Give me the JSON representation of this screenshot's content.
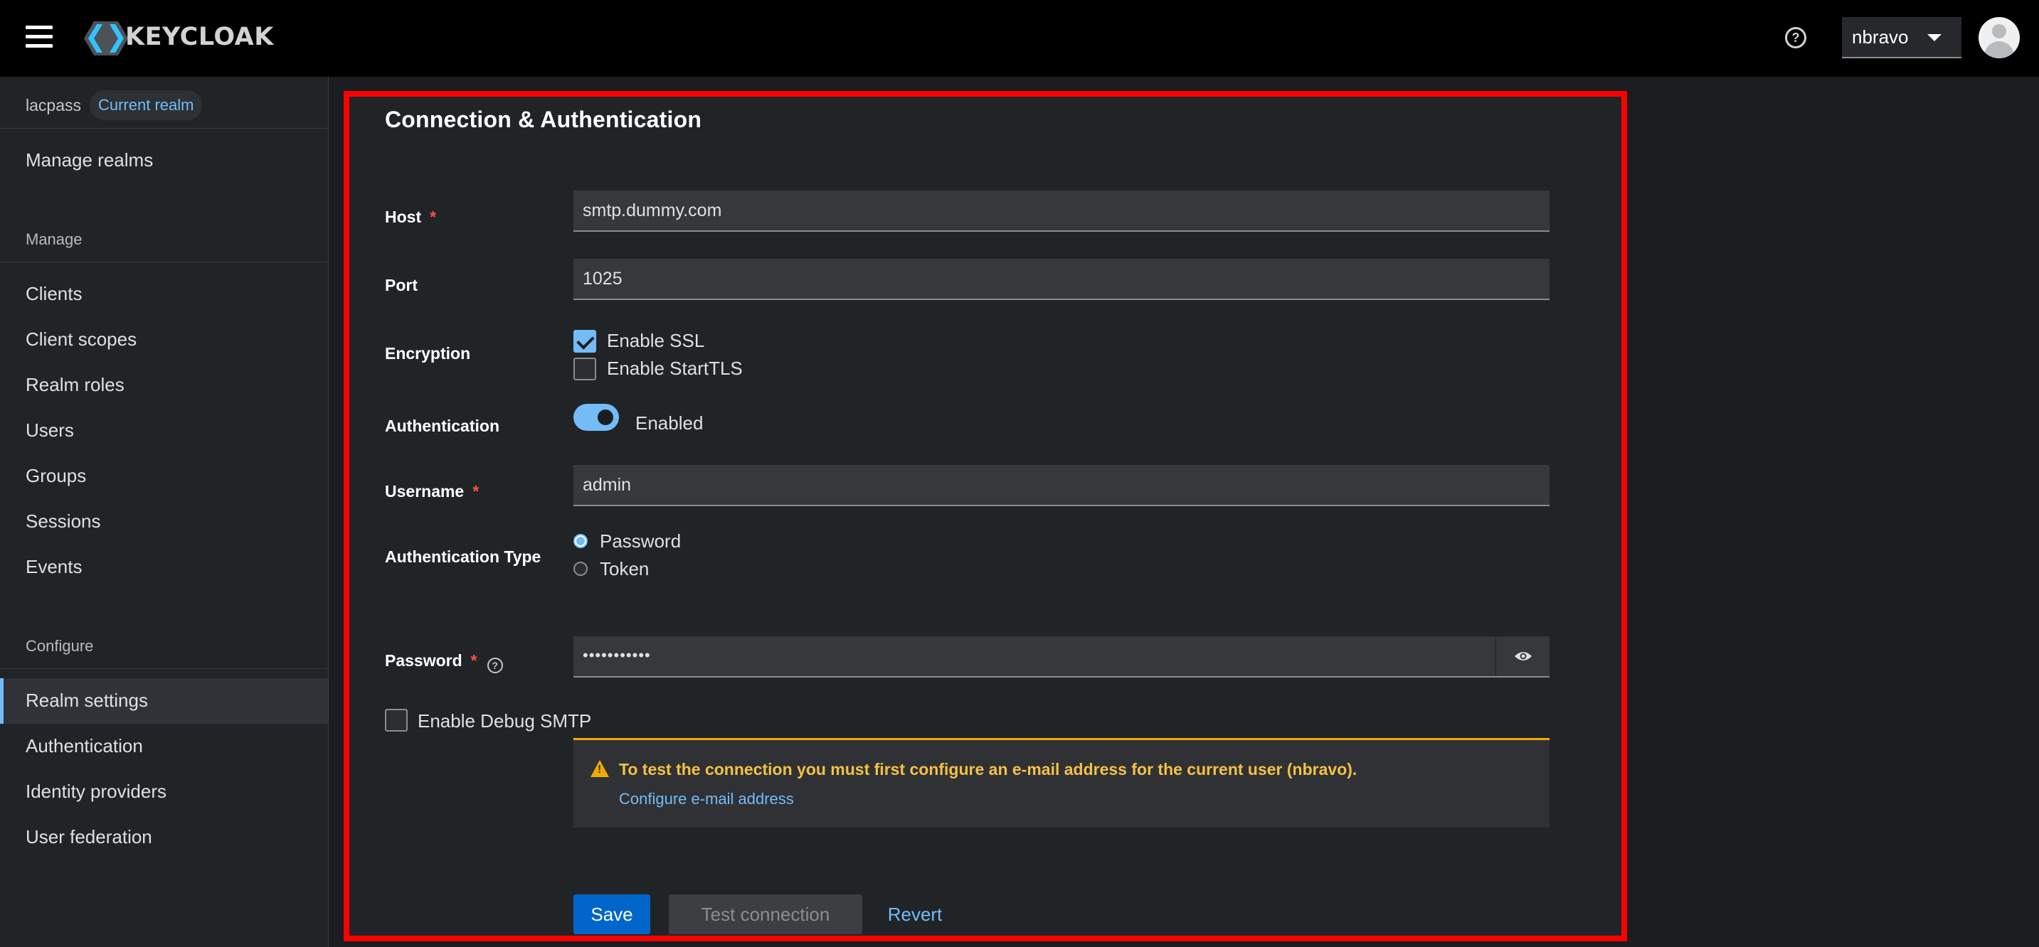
{
  "header": {
    "logo_text": "KEYCLOAK",
    "help_glyph": "?",
    "user_name": "nbravo"
  },
  "sidebar": {
    "realm_name": "lacpass",
    "realm_badge": "Current realm",
    "manage_realms": "Manage realms",
    "section_manage": "Manage",
    "manage_items": [
      "Clients",
      "Client scopes",
      "Realm roles",
      "Users",
      "Groups",
      "Sessions",
      "Events"
    ],
    "section_configure": "Configure",
    "configure_items": [
      "Realm settings",
      "Authentication",
      "Identity providers",
      "User federation"
    ],
    "active_item": "Realm settings"
  },
  "form": {
    "title": "Connection & Authentication",
    "required_mark": "*",
    "host": {
      "label": "Host",
      "value": "smtp.dummy.com"
    },
    "port": {
      "label": "Port",
      "value": "1025"
    },
    "encryption": {
      "label": "Encryption",
      "enable_ssl": {
        "label": "Enable SSL",
        "checked": true
      },
      "enable_starttls": {
        "label": "Enable StartTLS",
        "checked": false
      }
    },
    "authentication": {
      "label": "Authentication",
      "toggle_label": "Enabled",
      "enabled": true
    },
    "username": {
      "label": "Username",
      "value": "admin"
    },
    "auth_type": {
      "label": "Authentication Type",
      "options": [
        "Password",
        "Token"
      ],
      "selected": "Password"
    },
    "password": {
      "label": "Password",
      "help_glyph": "?",
      "masked_value": "•••••••••••"
    },
    "debug_smtp": {
      "label": "Enable Debug SMTP",
      "checked": false
    },
    "alert": {
      "text": "To test the connection you must first configure an e-mail address for the current user (nbravo).",
      "link": "Configure e-mail address"
    },
    "buttons": {
      "save": "Save",
      "test": "Test connection",
      "revert": "Revert"
    }
  },
  "colors": {
    "accent": "#73bcf7",
    "primary_button": "#0066cc",
    "warning": "#f0ab00",
    "highlight_border": "#ff0000"
  }
}
